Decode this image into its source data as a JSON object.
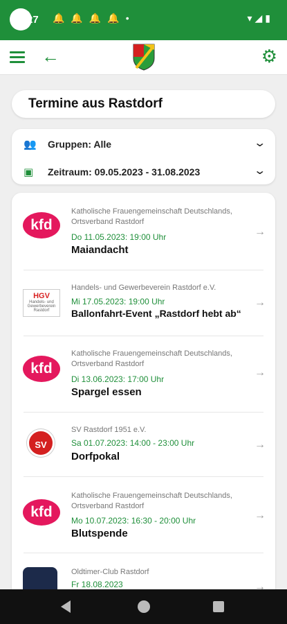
{
  "status_bar": {
    "time": ":27",
    "notification_icons": [
      "bell-icon",
      "bell-icon",
      "bell-icon",
      "bell-icon",
      "dot-icon"
    ],
    "system_icons": [
      "wifi-icon",
      "signal-icon",
      "battery-icon"
    ]
  },
  "appbar": {
    "menu_icon": "menu-icon",
    "back_icon": "arrow-left-icon",
    "logo_icon": "rastdorf-crest-icon",
    "settings_icon": "gear-icon"
  },
  "colors": {
    "accent": "#1f8f3a",
    "kfd": "#e4185d"
  },
  "page_title": "Termine aus Rastdorf",
  "filters": {
    "groups_label": "Gruppen: Alle",
    "period_label": "Zeitraum: 09.05.2023 - 31.08.2023"
  },
  "events": [
    {
      "logo_text": "kfd",
      "org": "Katholische Frauengemeinschaft Deutschlands, Ortsverband Rastdorf",
      "date": "Do 11.05.2023: 19:00 Uhr",
      "title": "Maiandacht"
    },
    {
      "logo_text": "HGV",
      "logo_sub": "Handels- und Gewerbeverein Rastdorf",
      "org": "Handels- und Gewerbeverein Rastdorf e.V.",
      "date": "Mi 17.05.2023: 19:00 Uhr",
      "title": "Ballonfahrt-Event „Rastdorf hebt ab“"
    },
    {
      "logo_text": "kfd",
      "org": "Katholische Frauengemeinschaft Deutschlands, Ortsverband Rastdorf",
      "date": "Di 13.06.2023: 17:00 Uhr",
      "title": "Spargel essen"
    },
    {
      "logo_text": "SV",
      "org": "SV Rastdorf 1951 e.V.",
      "date": "Sa 01.07.2023: 14:00 - 23:00 Uhr",
      "title": "Dorfpokal"
    },
    {
      "logo_text": "kfd",
      "org": "Katholische Frauengemeinschaft Deutschlands, Ortsverband Rastdorf",
      "date": "Mo 10.07.2023: 16:30 - 20:00 Uhr",
      "title": "Blutspende"
    },
    {
      "logo_text": "",
      "org": "Oldtimer-Club Rastdorf",
      "date": "Fr 18.08.2023",
      "title": ""
    }
  ]
}
